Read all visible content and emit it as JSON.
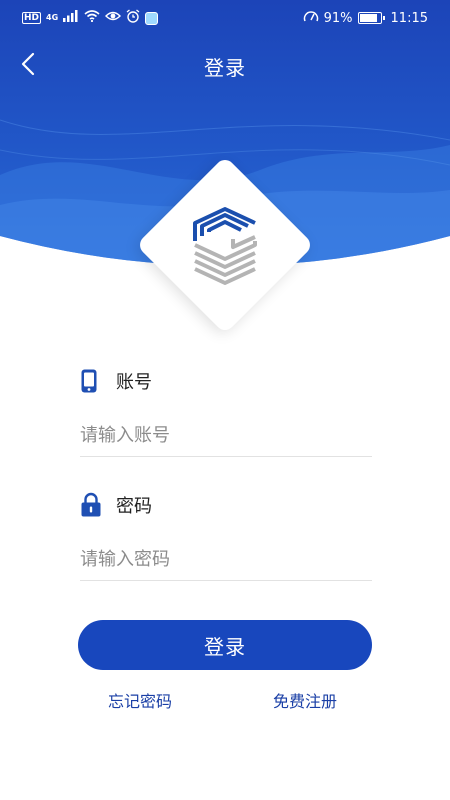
{
  "status_bar": {
    "hd": "HD",
    "network": "4G",
    "battery_percent": "91%",
    "battery_level": 0.91,
    "time": "11:15",
    "icons": [
      "signal-icon",
      "wifi-icon",
      "eye-icon",
      "alarm-icon",
      "app-notification-icon",
      "speed-icon",
      "battery-icon"
    ]
  },
  "nav": {
    "title": "登录",
    "back_icon": "chevron-left-icon"
  },
  "logo": {
    "icon": "company-logo"
  },
  "form": {
    "account": {
      "label": "账号",
      "placeholder": "请输入账号",
      "value": "",
      "icon": "phone-icon"
    },
    "password": {
      "label": "密码",
      "placeholder": "请输入密码",
      "value": "",
      "icon": "lock-icon"
    },
    "submit_label": "登录"
  },
  "links": {
    "forgot_password": "忘记密码",
    "register": "免费注册"
  },
  "colors": {
    "primary": "#1847bd",
    "header_dark": "#1a3fa8",
    "header_light": "#3b7ce0",
    "link": "#1a3fa6"
  }
}
